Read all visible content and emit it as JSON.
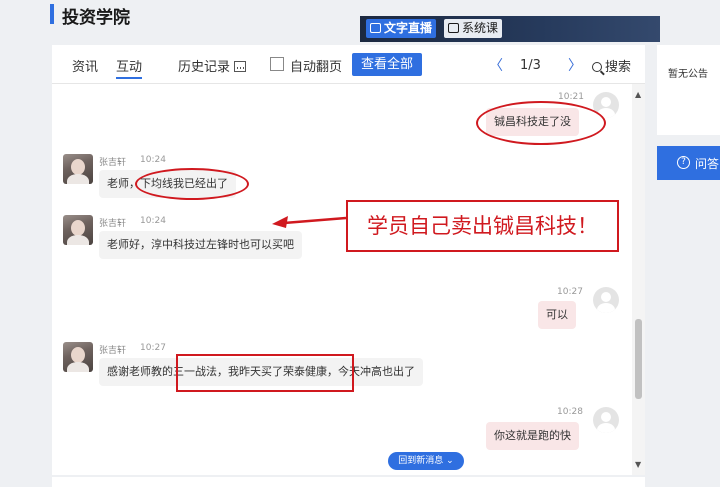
{
  "header": {
    "title": "投资学院",
    "tab_live": "文字直播",
    "tab_course": "系统课"
  },
  "toolbar": {
    "tab_news": "资讯",
    "tab_interact": "互动",
    "history": "历史记录",
    "auto_page": "自动翻页",
    "view_all": "查看全部",
    "page_indicator": "1/3",
    "search": "搜索"
  },
  "messages": [
    {
      "side": "right",
      "time": "10:21",
      "text": "铖昌科技走了没"
    },
    {
      "side": "left",
      "name": "张吉轩",
      "time": "10:24",
      "text": "老师，下均线我已经出了"
    },
    {
      "side": "left",
      "name": "张吉轩",
      "time": "10:24",
      "text": "老师好，淳中科技过左锋时也可以买吧"
    },
    {
      "side": "right",
      "time": "10:27",
      "text": "可以"
    },
    {
      "side": "left",
      "name": "张吉轩",
      "time": "10:27",
      "text": "感谢老师教的三一战法，我昨天买了荣泰健康，今天冲高也出了"
    },
    {
      "side": "right",
      "time": "10:28",
      "text": "你这就是跑的快"
    }
  ],
  "annotation": "学员自己卖出铖昌科技！",
  "new_messages_button": "回到新消息 ⌄",
  "sidebar": {
    "notice": "暂无公告",
    "qa_label": "问答"
  },
  "colors": {
    "accent": "#2f6fe0",
    "annotation_red": "#d0191f",
    "right_bubble": "#f9e6e7"
  }
}
